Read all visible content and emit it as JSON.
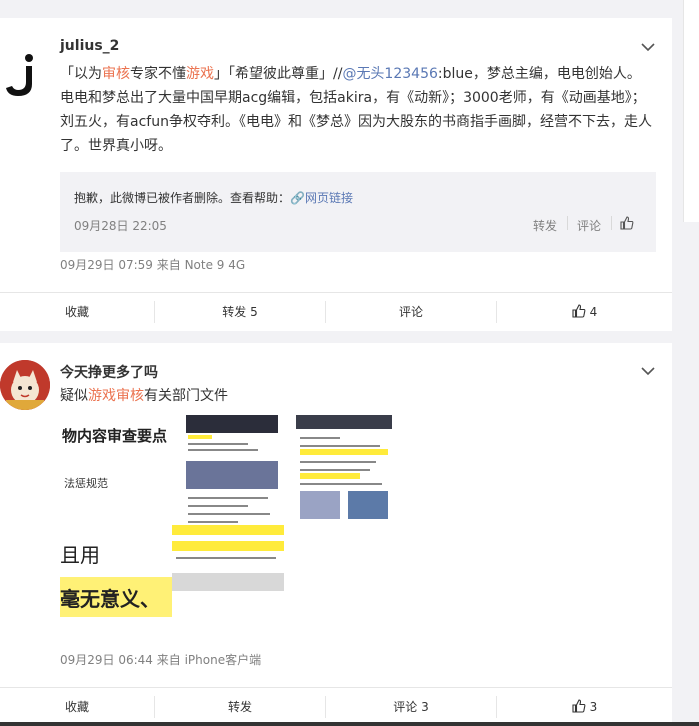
{
  "post1": {
    "username": "julius_2",
    "text": {
      "q1_open": "「以为",
      "q1_red1": "审核",
      "q1_mid": "专家不懂",
      "q1_red2": "游戏",
      "q1_close": "」「希望彼此尊重」//",
      "mention": "@无头123456",
      "line1_tail": ":blue，梦总主编，电电创始人。",
      "line2": "电电和梦总出了大量中国早期acg编辑，包括akira，有《动新》；3000老师，有《动画基地》；",
      "line3": "刘五火，有acfun争权夺利。《电电》和《梦总》因为大股东的书商指手画脚，经营不下去，走人",
      "line4": "了。世界真小呀。"
    },
    "repost": {
      "deleted_text": "抱歉，此微博已被作者删除。查看帮助：",
      "help_link": "网页链接",
      "date": "09月28日 22:05",
      "forward_label": "转发",
      "comment_label": "评论"
    },
    "meta": "09月29日 07:59  来自 Note 9 4G",
    "actions": {
      "favorite": "收藏",
      "forward": "转发 5",
      "comment": "评论",
      "like_count": "4"
    }
  },
  "post2": {
    "username": "今天挣更多了吗",
    "text": {
      "pre": "疑似",
      "red": "游戏审核",
      "post": "有关部门文件"
    },
    "images": {
      "img1_heading": "物内容审查要点",
      "img1_sub": "法惩规范",
      "img1_big1": "且用",
      "img1_big2": "毫无意义、"
    },
    "meta": "09月29日 06:44  来自 iPhone客户端",
    "actions": {
      "favorite": "收藏",
      "forward": "转发",
      "comment": "评论 3",
      "like_count": "3"
    }
  },
  "colors": {
    "link_blue": "#5a78b4",
    "highlight_orange": "#eb7350",
    "page_bg": "#f2f2f5"
  }
}
